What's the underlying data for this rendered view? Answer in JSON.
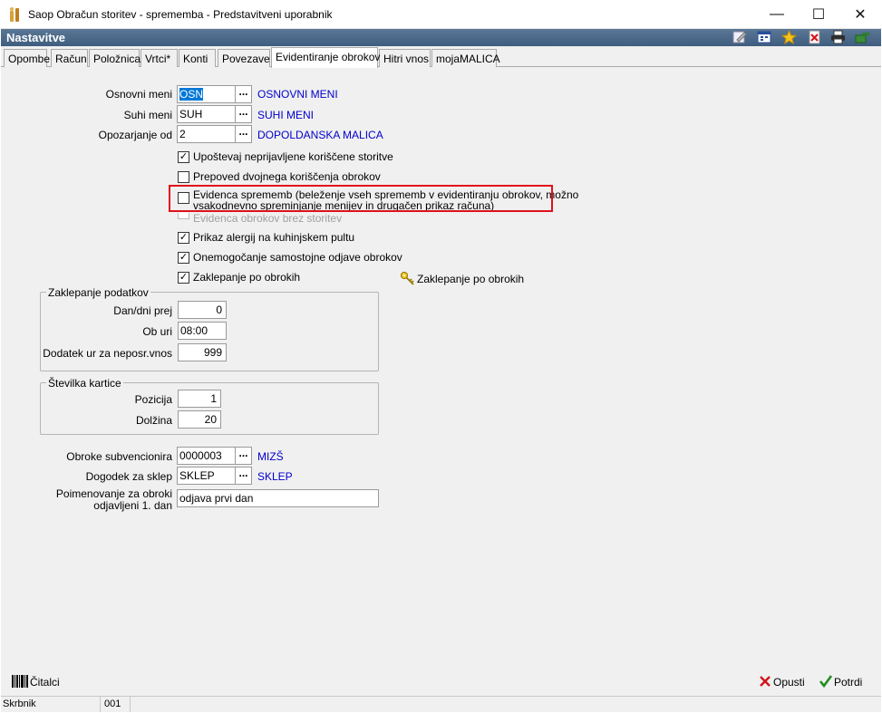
{
  "window": {
    "title": "Saop Obračun storitev - sprememba - Predstavitveni uporabnik",
    "minimize_glyph": "—",
    "maximize_glyph": "☐",
    "close_glyph": "✕"
  },
  "header": {
    "title": "Nastavitve",
    "toolbar_icons": [
      "edit-icon",
      "calendar-icon",
      "favorite-star-icon",
      "delete-icon",
      "print-icon",
      "export-icon"
    ]
  },
  "tabs": [
    {
      "label": "Opombe"
    },
    {
      "label": "Račun"
    },
    {
      "label": "Položnica"
    },
    {
      "label": "Vrtci*"
    },
    {
      "label": "Konti"
    },
    {
      "label": "Povezave"
    },
    {
      "label": "Evidentiranje obrokov",
      "active": true
    },
    {
      "label": "Hitri vnos"
    },
    {
      "label": "mojaMALICA"
    }
  ],
  "form": {
    "osnovni_meni": {
      "label": "Osnovni meni",
      "value": "OSN",
      "link": "OSNOVNI MENI"
    },
    "suhi_meni": {
      "label": "Suhi meni",
      "value": "SUH",
      "link": "SUHI MENI"
    },
    "opozarjanje_od": {
      "label": "Opozarjanje od",
      "value": "2",
      "link": "DOPOLDANSKA MALICA"
    },
    "dots": "...",
    "checkboxes": {
      "upostevaj": {
        "label": "Upoštevaj neprijavljene koriščene storitve",
        "checked": true
      },
      "prepoved": {
        "label": "Prepoved dvojnega koriščenja  obrokov",
        "checked": false
      },
      "evidenca_line1": "Evidenca sprememb (beleženje vseh sprememb v evidentiranju obrokov, možno",
      "evidenca_line2": "vsakodnevno spreminjanje menijev in drugačen prikaz računa)",
      "evidenca_brez": {
        "label": "Evidenca obrokov brez storitev",
        "checked": false,
        "disabled": true
      },
      "alergije": {
        "label": "Prikaz alergij na kuhinjskem pultu",
        "checked": true
      },
      "onemogocanje": {
        "label": "Onemogočanje samostojne odjave obrokov",
        "checked": true
      },
      "zaklepanje": {
        "label": "Zaklepanje po obrokih",
        "checked": true
      }
    },
    "check_glyph": "✓",
    "zaklepanje_button": "Zaklepanje po obrokih",
    "zaklepanje_group": {
      "title": "Zaklepanje podatkov",
      "dan_label": "Dan/dni prej",
      "dan_value": "0",
      "ob_uri_label": "Ob uri",
      "ob_uri_value": "08:00",
      "dodatek_label": "Dodatek ur za neposr.vnos",
      "dodatek_value": "999"
    },
    "kartica_group": {
      "title": "Številka kartice",
      "pozicija_label": "Pozicija",
      "pozicija_value": "1",
      "dolzina_label": "Dolžina",
      "dolzina_value": "20"
    },
    "obroke_subvencionira": {
      "label": "Obroke subvencionira",
      "value": "0000003",
      "link": "MIZŠ"
    },
    "dogodek_za_sklep": {
      "label": "Dogodek za sklep",
      "value": "SKLEP",
      "link": "SKLEP"
    },
    "poimenovanje": {
      "label_line1": "Poimenovanje za obroki",
      "label_line2": "odjavljeni 1. dan",
      "value": "odjava prvi dan"
    }
  },
  "bottom": {
    "citalci": "Čitalci",
    "opusti": "Opusti",
    "potrdi": "Potrdi"
  },
  "status": {
    "cell1": "Skrbnik",
    "cell2": "001"
  },
  "colors": {
    "header_band": "#4a6a8c",
    "link": "#0000cc",
    "highlight_border": "#e0101a",
    "selection": "#0078d7"
  }
}
